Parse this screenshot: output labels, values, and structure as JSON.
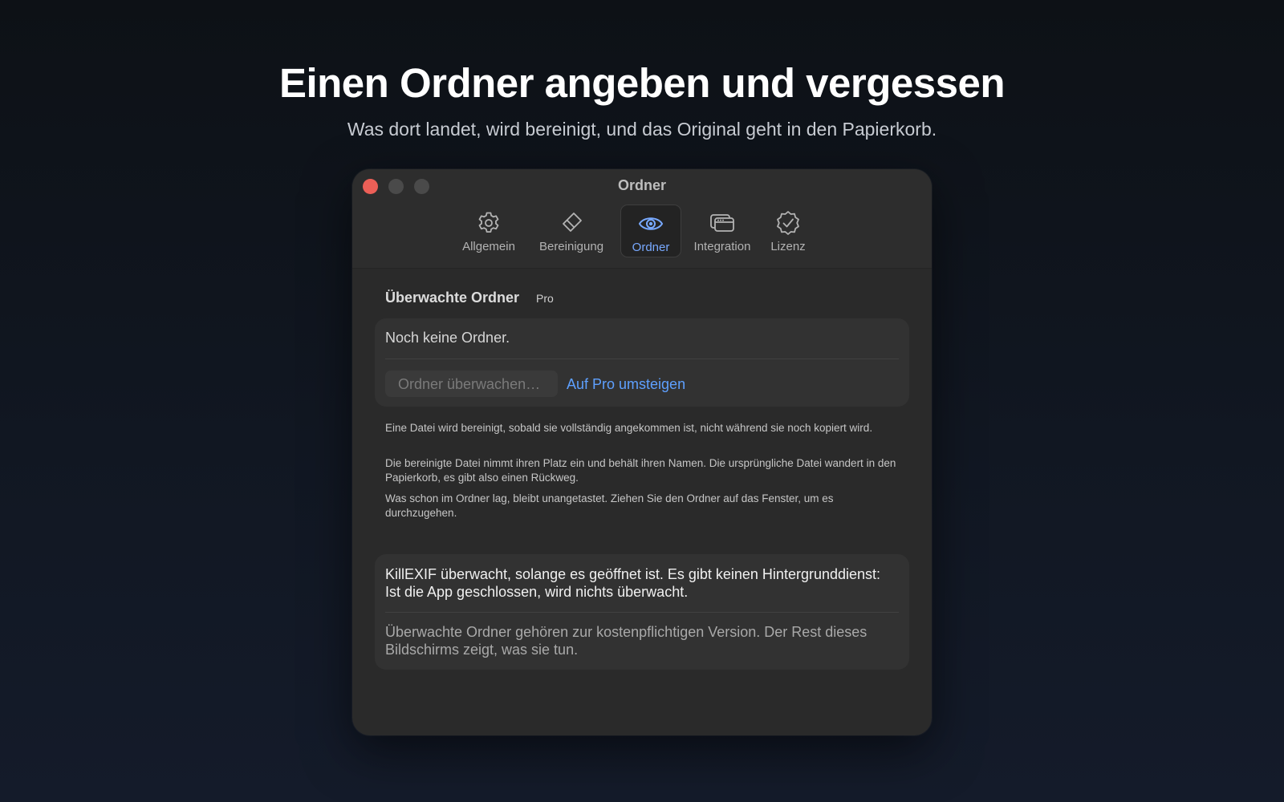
{
  "hero": {
    "title": "Einen Ordner angeben und vergessen",
    "subtitle": "Was dort landet, wird bereinigt, und das Original geht in den Papierkorb."
  },
  "window": {
    "title": "Ordner",
    "tabs": [
      {
        "label": "Allgemein",
        "icon": "gear-icon",
        "active": false
      },
      {
        "label": "Bereinigung",
        "icon": "eraser-icon",
        "active": false
      },
      {
        "label": "Ordner",
        "icon": "eye-icon",
        "active": true
      },
      {
        "label": "Integration",
        "icon": "windows-icon",
        "active": false
      },
      {
        "label": "Lizenz",
        "icon": "checkmark-seal-icon",
        "active": false
      }
    ]
  },
  "folders": {
    "heading": "Überwachte Ordner",
    "badge": "Pro",
    "empty_text": "Noch keine Ordner.",
    "watch_button": "Ordner überwachen…",
    "upgrade_link": "Auf Pro umsteigen"
  },
  "info": [
    "Eine Datei wird bereinigt, sobald sie vollständig angekommen ist, nicht während sie noch kopiert wird.",
    "Die bereinigte Datei nimmt ihren Platz ein und behält ihren Namen. Die ursprüngliche Datei wandert in den Papierkorb, es gibt also einen Rückweg.",
    "Was schon im Ordner lag, bleibt unangetastet. Ziehen Sie den Ordner auf das Fenster, um es durchzugehen."
  ],
  "notice": {
    "main": "KillEXIF überwacht, solange es geöffnet ist. Es gibt keinen Hintergrunddienst: Ist die App geschlossen, wird nichts überwacht.",
    "secondary": "Überwachte Ordner gehören zur kostenpflichtigen Version. Der Rest dieses Bildschirms zeigt, was sie tun."
  },
  "colors": {
    "accent": "#5ea0ff",
    "active_tab": "#78a9ff",
    "close_button": "#ec5f57"
  }
}
